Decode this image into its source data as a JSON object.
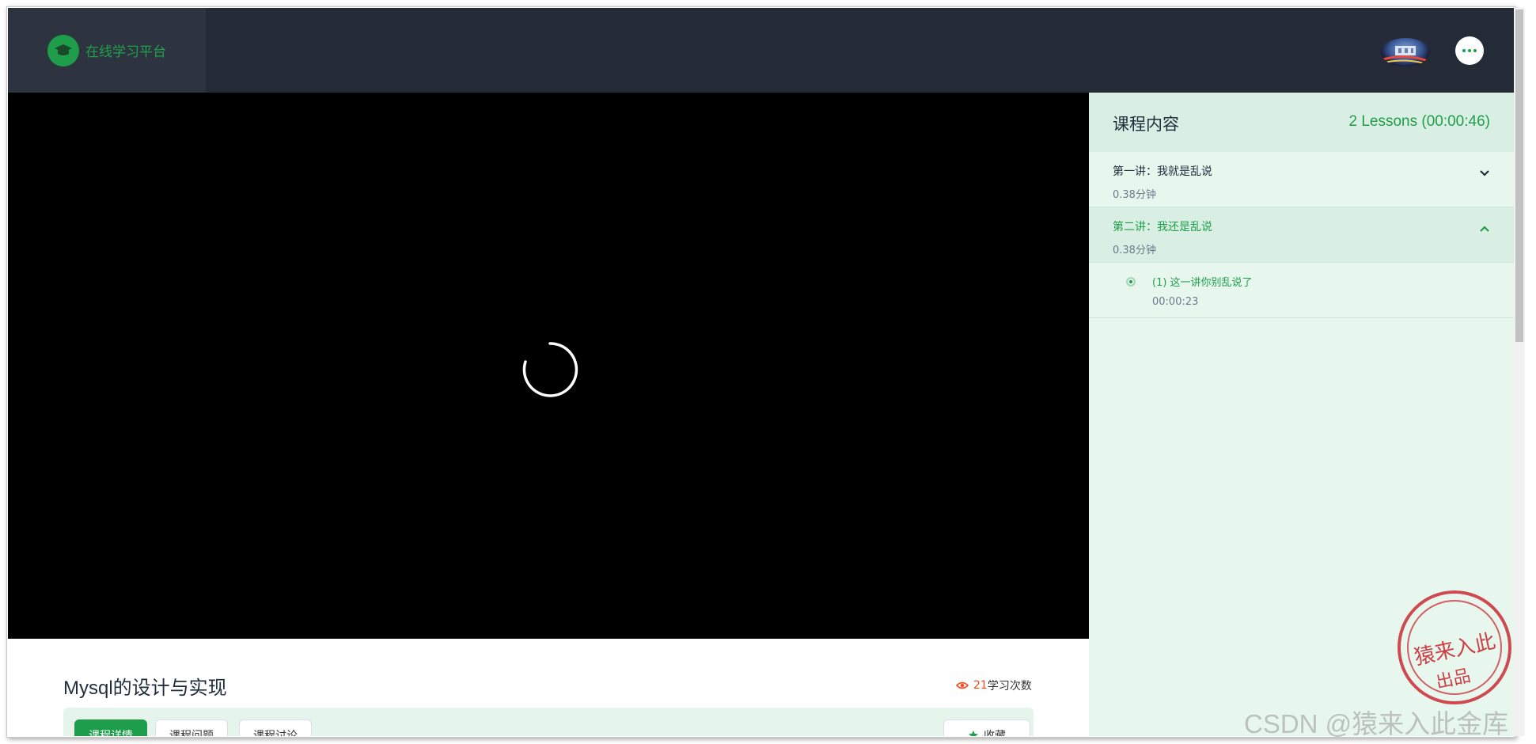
{
  "header": {
    "logo_text": "在线学习平台",
    "logo_icon": "graduation-cap-icon",
    "more_icon": "more-dots-icon"
  },
  "video": {
    "state": "loading",
    "spinner_icon": "loading-spinner-icon"
  },
  "course": {
    "title": "Mysql的设计与实现",
    "views_count": "21",
    "views_label": "学习次数",
    "tabs": [
      {
        "label": "课程详情"
      },
      {
        "label": "课程问题"
      },
      {
        "label": "课程讨论"
      }
    ],
    "favorite_label": "收藏"
  },
  "sidebar": {
    "title": "课程内容",
    "summary": "2 Lessons (00:00:46)",
    "sections": [
      {
        "name": "第一讲：我就是乱说",
        "duration": "0.38分钟",
        "expanded": false
      },
      {
        "name": "第二讲：我还是乱说",
        "duration": "0.38分钟",
        "expanded": true
      }
    ],
    "lessons": [
      {
        "name": "(1) 这一讲你别乱说了",
        "time": "00:00:23"
      }
    ]
  },
  "watermark": {
    "stamp_line1": "猿来入此",
    "stamp_line2": "出品",
    "text": "CSDN @猿来入此金库"
  },
  "colors": {
    "brand_green": "#1e9e4a",
    "header_bg": "#252b36",
    "sidebar_bg": "#e8f7ee",
    "views_accent": "#f04e23"
  }
}
